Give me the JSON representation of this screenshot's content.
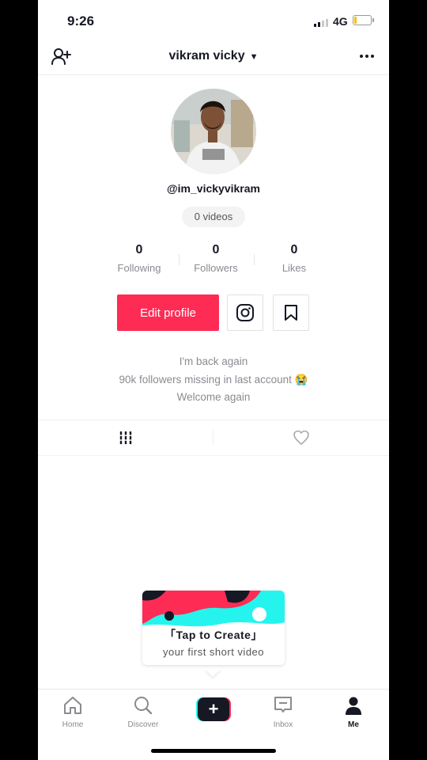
{
  "status_bar": {
    "time": "9:26",
    "network": "4G",
    "battery_level": 0.12
  },
  "header": {
    "title": "vikram vicky"
  },
  "profile": {
    "handle": "@im_vickyvikram",
    "videos_count": "0 videos",
    "stats": [
      {
        "value": "0",
        "label": "Following"
      },
      {
        "value": "0",
        "label": "Followers"
      },
      {
        "value": "0",
        "label": "Likes"
      }
    ],
    "edit_label": "Edit profile",
    "bio": [
      "I'm back again",
      "90k followers missing in last account 😭",
      "Welcome again"
    ]
  },
  "create_prompt": {
    "line1": "「Tap to Create」",
    "line2": "your first short video"
  },
  "bottom_nav": {
    "home": "Home",
    "discover": "Discover",
    "inbox": "Inbox",
    "me": "Me"
  },
  "colors": {
    "accent": "#fe2c55",
    "cyan": "#25f4ee",
    "text": "#161823",
    "muted": "#8a8b91"
  },
  "icons": [
    "add-user-icon",
    "more-icon",
    "instagram-icon",
    "bookmark-icon",
    "grid-icon",
    "heart-icon",
    "home-icon",
    "search-icon",
    "plus-icon",
    "inbox-icon",
    "me-icon"
  ]
}
